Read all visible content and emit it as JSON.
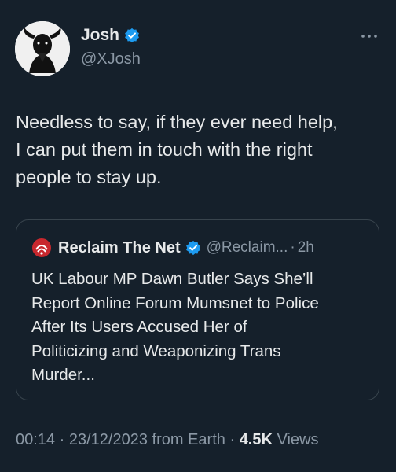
{
  "author": {
    "display_name": "Josh",
    "handle": "@XJosh",
    "verified": true,
    "avatar_icon": "bull-silhouette-avatar"
  },
  "tweet": {
    "text": "Needless to say, if they ever need help,\nI can put them in touch with the right\npeople to stay up."
  },
  "quote": {
    "account_name": "Reclaim The Net",
    "handle": "@Reclaim...",
    "separator": "·",
    "time": "2h",
    "verified": true,
    "logo_icon": "reclaim-the-net-logo",
    "text": "UK Labour MP Dawn Butler Says She’ll\nReport Online Forum Mumsnet to Police\nAfter Its Users Accused Her of\nPoliticizing and Weaponizing Trans\nMurder..."
  },
  "meta": {
    "time": "00:14",
    "sep1": "·",
    "date": "23/12/2023",
    "source": "from Earth",
    "sep2": "·",
    "views_count": "4.5K",
    "views_label": "Views"
  },
  "colors": {
    "background": "#15202b",
    "text_primary": "#e7e9ea",
    "text_secondary": "#8b98a5",
    "verified_blue": "#1d9bf0",
    "border": "#38444d",
    "logo_red": "#c8282e"
  },
  "icons": {
    "more": "more-horizontal-icon",
    "verified": "verified-badge-icon"
  }
}
